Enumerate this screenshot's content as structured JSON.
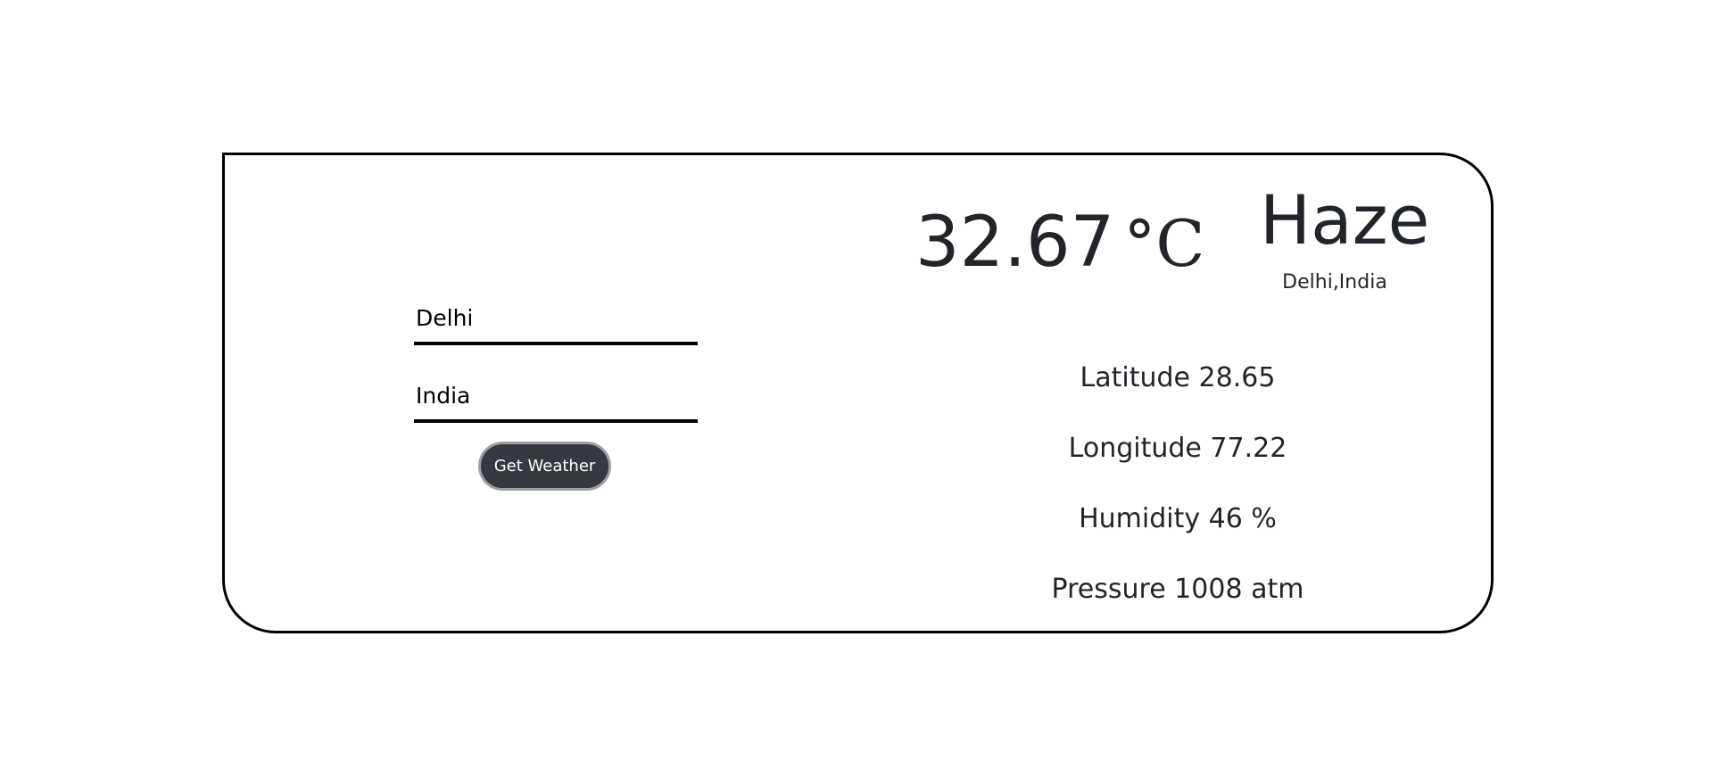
{
  "form": {
    "city_value": "Delhi",
    "country_value": "India",
    "button_label": "Get Weather"
  },
  "weather": {
    "temperature": "32.67",
    "temperature_unit": "°C",
    "condition": "Haze",
    "location": "Delhi,India",
    "latitude": "Latitude 28.65",
    "longitude": "Longitude 77.22",
    "humidity": "Humidity 46 %",
    "pressure": "Pressure 1008 atm"
  }
}
